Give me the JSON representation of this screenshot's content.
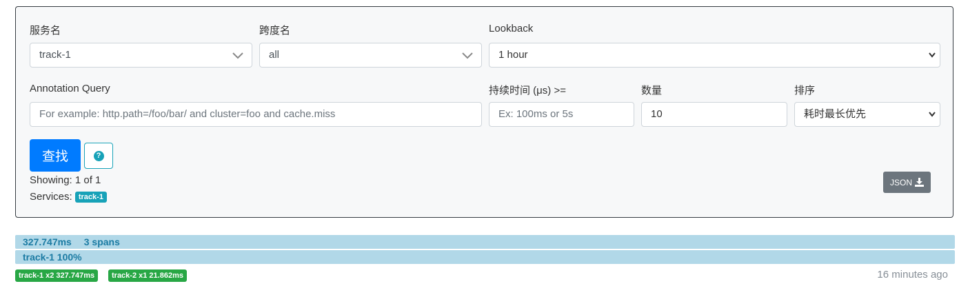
{
  "form": {
    "service_label": "服务名",
    "service_value": "track-1",
    "span_label": "跨度名",
    "span_value": "all",
    "lookback_label": "Lookback",
    "lookback_value": "1 hour",
    "annotation_label": "Annotation Query",
    "annotation_placeholder": "For example: http.path=/foo/bar/ and cluster=foo and cache.miss",
    "duration_label": "持续时间 (μs) >=",
    "duration_placeholder": "Ex: 100ms or 5s",
    "limit_label": "数量",
    "limit_value": "10",
    "sort_label": "排序",
    "sort_value": "耗时最长优先",
    "search_label": "查找",
    "help_icon": "question-circle-icon"
  },
  "results": {
    "showing": "Showing: 1 of 1",
    "services_label": "Services:",
    "services": [
      "track-1"
    ],
    "json_label": "JSON",
    "json_icon": "download-icon"
  },
  "trace": {
    "duration": "327.747ms",
    "spans": "3 spans",
    "service_pct": "track-1 100%",
    "service_badges": [
      "track-1 x2 327.747ms",
      "track-2 x1 21.862ms"
    ],
    "time_ago": "16 minutes ago"
  },
  "colors": {
    "primary": "#007bff",
    "info": "#17a2b8",
    "success": "#28a745",
    "secondary": "#6c757d",
    "trace_bar": "#b1d8e8",
    "trace_text": "#1b7ba3"
  }
}
